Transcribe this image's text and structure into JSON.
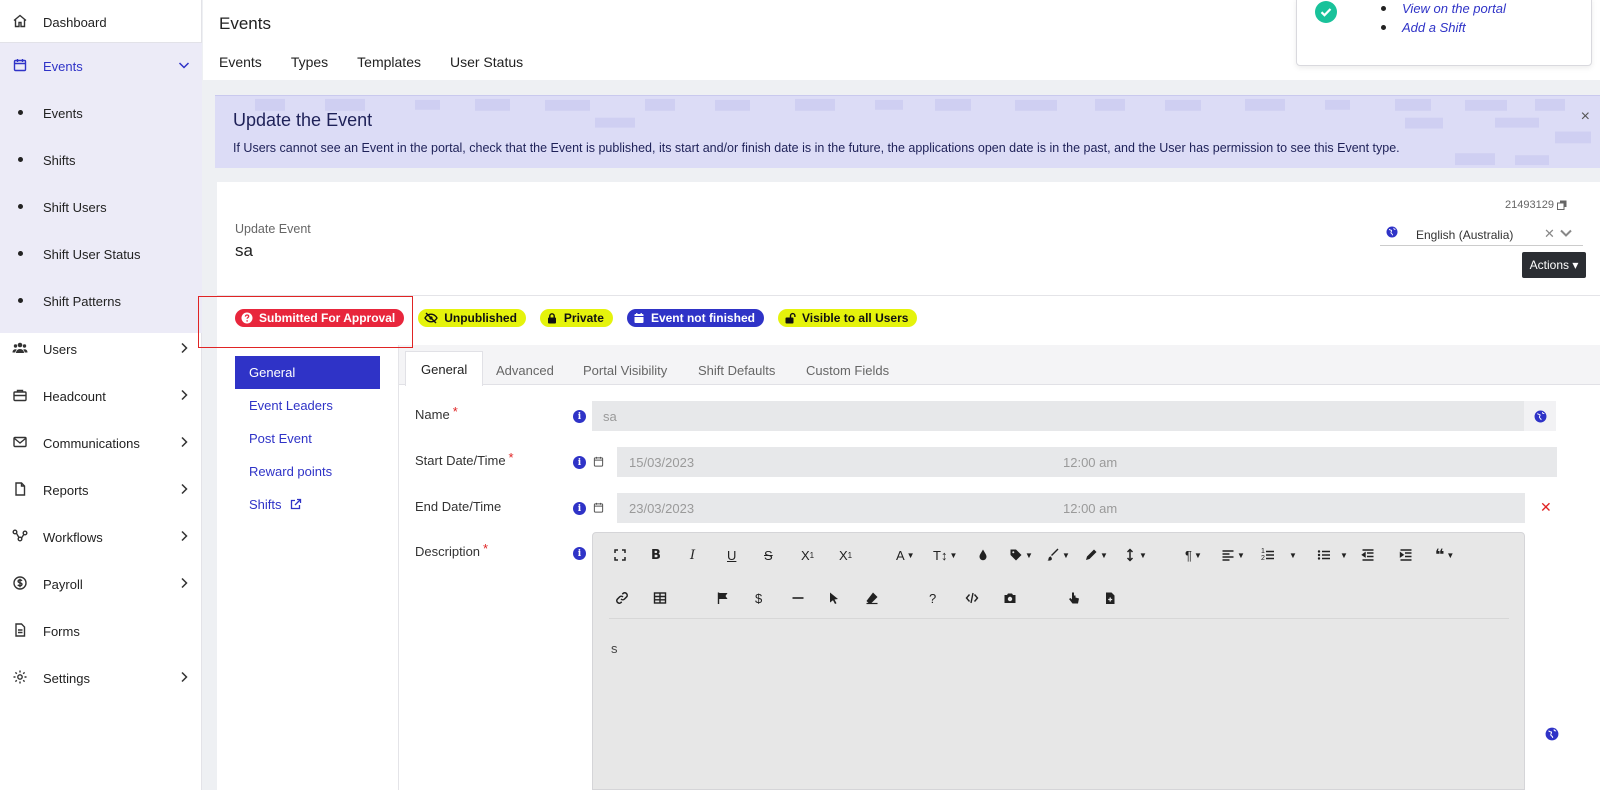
{
  "sidebar": {
    "items": [
      {
        "label": "Dashboard",
        "icon": "home-icon"
      },
      {
        "label": "Events",
        "icon": "calendar-icon",
        "active": true
      },
      {
        "label": "Users",
        "icon": "users-icon"
      },
      {
        "label": "Headcount",
        "icon": "briefcase-icon"
      },
      {
        "label": "Communications",
        "icon": "envelope-icon"
      },
      {
        "label": "Reports",
        "icon": "document-icon"
      },
      {
        "label": "Workflows",
        "icon": "workflow-icon"
      },
      {
        "label": "Payroll",
        "icon": "dollar-circle-icon"
      },
      {
        "label": "Forms",
        "icon": "form-icon"
      },
      {
        "label": "Settings",
        "icon": "gear-icon"
      }
    ],
    "events_subitems": [
      "Events",
      "Shifts",
      "Shift Users",
      "Shift User Status",
      "Shift Patterns"
    ]
  },
  "header": {
    "title": "Events",
    "tabs": [
      "Events",
      "Types",
      "Templates",
      "User Status"
    ]
  },
  "popup": {
    "links": [
      "View on the portal",
      "Add a Shift"
    ]
  },
  "alert": {
    "title": "Update the Event",
    "text": "If Users cannot see an Event in the portal, check that the Event is published, its start and/or finish date is in the future, the applications open date is in the past, and the User has permission to see this Event type.",
    "close": "×"
  },
  "event": {
    "update_label": "Update Event",
    "name": "sa",
    "record_id": "21493129",
    "language": "English (Australia)",
    "actions_label": "Actions ▾"
  },
  "badges": [
    {
      "label": "Submitted For Approval",
      "style": "red",
      "icon": "question-circle-icon"
    },
    {
      "label": "Unpublished",
      "style": "yellow",
      "icon": "eye-slash-icon"
    },
    {
      "label": "Private",
      "style": "yellow",
      "icon": "lock-icon"
    },
    {
      "label": "Event not finished",
      "style": "blue",
      "icon": "calendar-icon"
    },
    {
      "label": "Visible to all Users",
      "style": "yellow",
      "icon": "unlock-icon"
    }
  ],
  "left_menu": [
    "General",
    "Event Leaders",
    "Post Event",
    "Reward points",
    "Shifts"
  ],
  "form_tabs": [
    "General",
    "Advanced",
    "Portal Visibility",
    "Shift Defaults",
    "Custom Fields"
  ],
  "fields": {
    "name_label": "Name",
    "name_value": "sa",
    "start_label": "Start Date/Time",
    "start_date": "15/03/2023",
    "start_time": "12:00 am",
    "end_label": "End Date/Time",
    "end_date": "23/03/2023",
    "end_time": "12:00 am",
    "description_label": "Description",
    "description_value": "s",
    "required_mark": "*"
  },
  "colors": {
    "primary": "#2f33c7",
    "badge_red": "#e8263c",
    "badge_yellow": "#e5f30c",
    "success": "#19c29a"
  }
}
